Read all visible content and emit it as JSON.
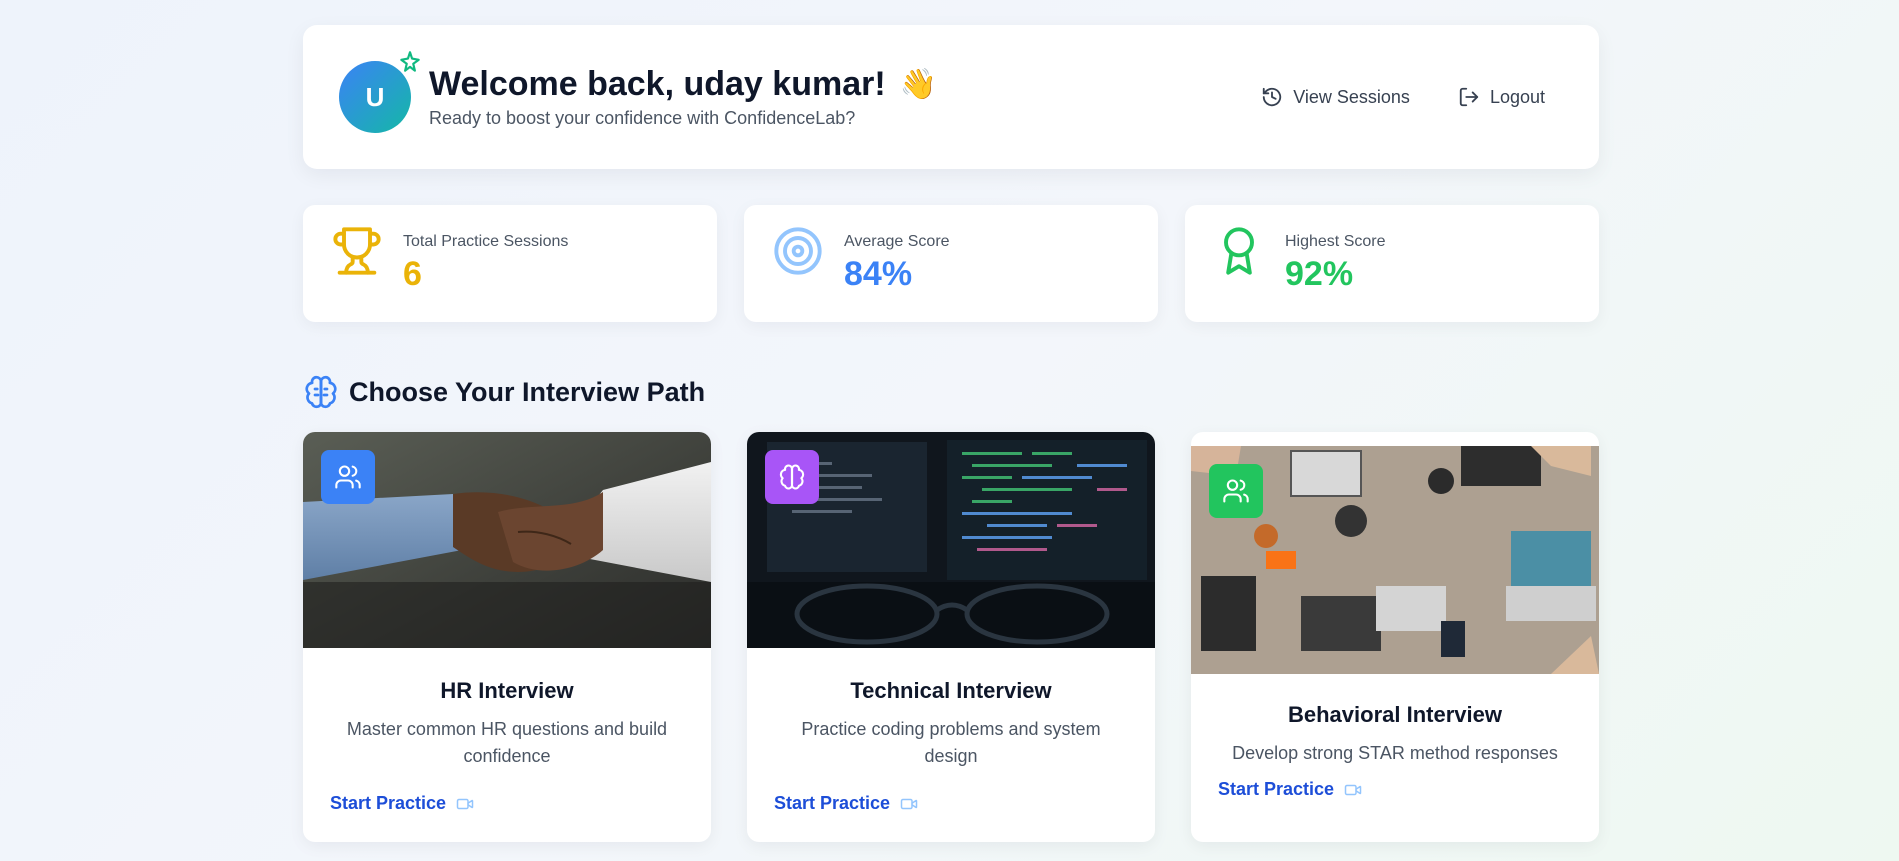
{
  "header": {
    "avatar_initial": "U",
    "welcome_title": "Welcome back, uday kumar!",
    "wave_emoji": "👋",
    "subtitle": "Ready to boost your confidence with ConfidenceLab?",
    "actions": [
      {
        "label": "View Sessions",
        "icon": "history-icon"
      },
      {
        "label": "Logout",
        "icon": "logout-icon"
      }
    ]
  },
  "stats": [
    {
      "label": "Total Practice Sessions",
      "value": "6",
      "icon": "trophy-icon",
      "color": "#eab308"
    },
    {
      "label": "Average Score",
      "value": "84%",
      "icon": "target-icon",
      "color": "#3b82f6"
    },
    {
      "label": "Highest Score",
      "value": "92%",
      "icon": "award-icon",
      "color": "#22c55e"
    }
  ],
  "section": {
    "title": "Choose Your Interview Path",
    "icon": "brain-icon"
  },
  "paths": [
    {
      "title": "HR Interview",
      "description": "Master common HR questions and build confidence",
      "cta": "Start Practice",
      "badge_icon": "users-icon",
      "badge_color": "#3b82f6"
    },
    {
      "title": "Technical Interview",
      "description": "Practice coding problems and system design",
      "cta": "Start Practice",
      "badge_icon": "brain-icon",
      "badge_color": "#a855f7"
    },
    {
      "title": "Behavioral Interview",
      "description": "Develop strong STAR method responses",
      "cta": "Start Practice",
      "badge_icon": "users-icon",
      "badge_color": "#22c55e"
    }
  ],
  "colors": {
    "accent": "#1d4ed8",
    "card": "#ffffff",
    "text": "#0f172a"
  }
}
